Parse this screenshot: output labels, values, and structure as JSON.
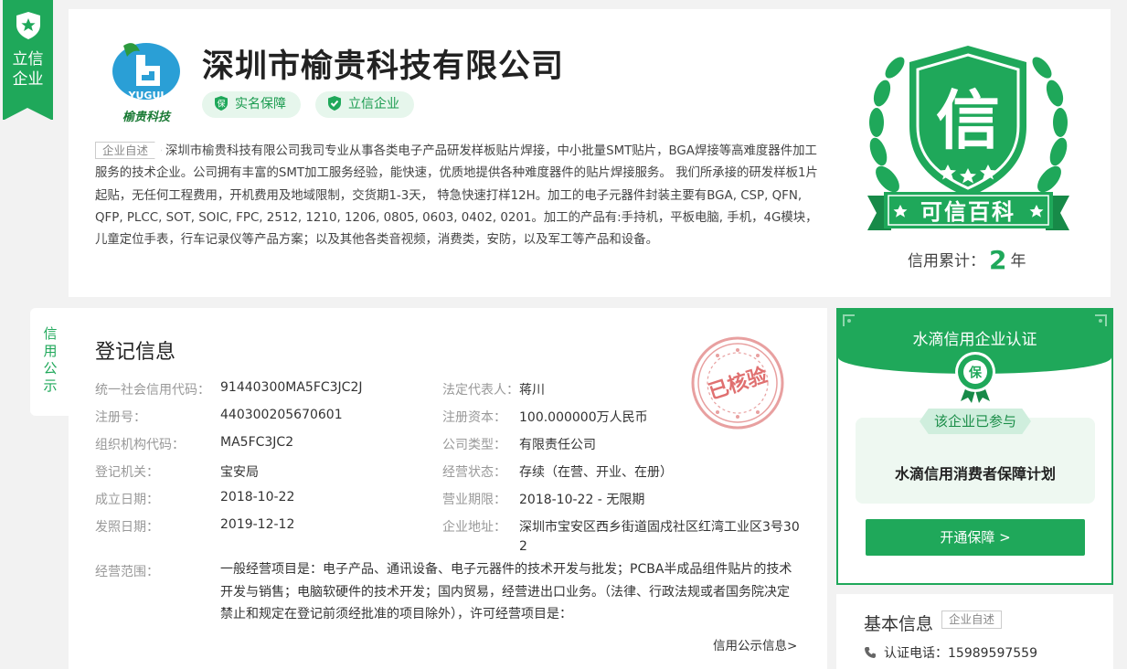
{
  "ribbon": {
    "line1": "立信",
    "line2": "企业"
  },
  "company": {
    "name": "深圳市榆贵科技有限公司",
    "logo_text_en": "YUGUI",
    "logo_text_cn": "榆贵科技",
    "badges": [
      "实名保障",
      "立信企业"
    ]
  },
  "intro": {
    "tag": "企业自述",
    "text": "深圳市榆贵科技有限公司我司专业从事各类电子产品研发样板贴片焊接，中小批量SMT贴片，BGA焊接等高难度器件加工服务的技术企业。公司拥有丰富的SMT加工服务经验，能快速，优质地提供各种难度器件的贴片焊接服务。  我们所承接的研发样板1片起贴，无任何工程费用，开机费用及地域限制，交货期1-3天，  特急快速打样12H。加工的电子元器件封装主要有BGA, CSP, QFN, QFP, PLCC, SOT, SOIC, FPC, 2512, 1210, 1206, 0805, 0603, 0402, 0201。加工的产品有:手持机，平板电脑, 手机，4G模块，儿童定位手表，行车记录仪等产品方案；以及其他各类音视频，消费类，安防，以及军工等产品和设备。"
  },
  "credit_seal": {
    "big_char": "信",
    "banner": "可信百科"
  },
  "credit_years": {
    "prefix": "信用累计：",
    "value": "2",
    "suffix": "年"
  },
  "side_tab": {
    "chars": [
      "信",
      "用",
      "公",
      "示"
    ]
  },
  "registration": {
    "title": "登记信息",
    "stamp_text": "已核验",
    "left": [
      {
        "label": "统一社会信用代码：",
        "value": "91440300MA5FC3JC2J"
      },
      {
        "label": "注册号：",
        "value": "440300205670601"
      },
      {
        "label": "组织机构代码：",
        "value": "MA5FC3JC2"
      },
      {
        "label": "登记机关：",
        "value": "宝安局"
      },
      {
        "label": "成立日期：",
        "value": "2018-10-22"
      },
      {
        "label": "发照日期：",
        "value": "2019-12-12"
      }
    ],
    "right": [
      {
        "label": "法定代表人：",
        "value": "蒋川"
      },
      {
        "label": "注册资本：",
        "value": "100.000000万人民币"
      },
      {
        "label": "公司类型：",
        "value": "有限责任公司"
      },
      {
        "label": "经营状态：",
        "value": "存续（在营、开业、在册）"
      },
      {
        "label": "营业期限：",
        "value": "2018-10-22 - 无限期"
      },
      {
        "label": "企业地址：",
        "value_line1": "深圳市宝安区西乡街道固戍社区红湾工业区3号30",
        "value_line2": "2"
      }
    ],
    "scope_label": "经营范围：",
    "scope_text": "一般经营项目是：电子产品、通讯设备、电子元器件的技术开发与批发；PCBA半成品组件贴片的技术开发与销售；电脑软硬件的技术开发；国内贸易，经营进出口业务。（法律、行政法规或者国务院决定禁止和规定在登记前须经批准的项目除外），许可经营项目是：",
    "more_link": "信用公示信息>"
  },
  "cert": {
    "title": "水滴信用企业认证",
    "medal_char": "保",
    "joined": "该企业已参与",
    "plan": "水滴信用消费者保障计划",
    "button": "开通保障 >"
  },
  "basic": {
    "title": "基本信息",
    "tag": "企业自述",
    "phone_label": "认证电话：",
    "phone": "15989597559"
  },
  "colors": {
    "brand_green": "#1fa85a",
    "stamp_red": "#e05a5a"
  }
}
